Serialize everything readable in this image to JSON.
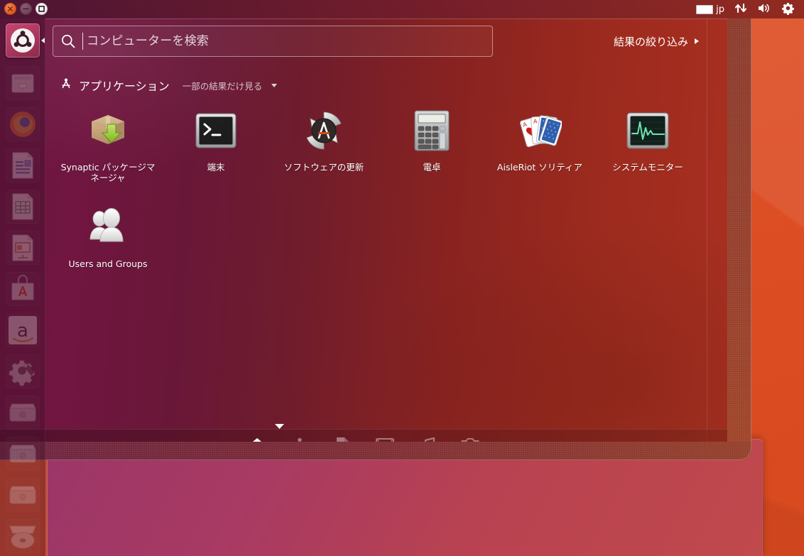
{
  "panel": {
    "window_buttons": [
      {
        "name": "close",
        "label": "閉じる"
      },
      {
        "name": "minimize",
        "label": "最小化"
      },
      {
        "name": "maximize",
        "label": "最大化"
      }
    ],
    "indicators": [
      {
        "name": "keyboard",
        "icon": "keyboard-layout-icon",
        "label": "jp"
      },
      {
        "name": "network",
        "icon": "network-arrows-icon",
        "label": ""
      },
      {
        "name": "sound",
        "icon": "volume-icon",
        "label": ""
      },
      {
        "name": "session",
        "icon": "gear-icon",
        "label": ""
      }
    ]
  },
  "dash": {
    "search": {
      "placeholder": "コンピューターを検索",
      "value": "",
      "icon": "search-icon"
    },
    "filter_results": {
      "label": "結果の絞り込み",
      "icon": "triangle-right-icon"
    },
    "category": {
      "icon": "applications-lens-icon",
      "title": "アプリケーション",
      "see_fewer_label": "一部の結果だけ見る",
      "arrow_icon": "chevron-down-icon"
    },
    "results": [
      {
        "label": "Synaptic パッケージマネージャ",
        "icon": "synaptic-package-manager-icon"
      },
      {
        "label": "端末",
        "icon": "terminal-icon"
      },
      {
        "label": "ソフトウェアの更新",
        "icon": "software-updater-icon"
      },
      {
        "label": "電卓",
        "icon": "calculator-icon"
      },
      {
        "label": "AisleRiot ソリティア",
        "icon": "aisleriot-solitaire-icon"
      },
      {
        "label": "システムモニター",
        "icon": "system-monitor-icon"
      },
      {
        "label": "Users and Groups",
        "icon": "users-and-groups-icon"
      }
    ],
    "lenses": [
      {
        "name": "home",
        "icon": "home-icon",
        "label": "ホーム",
        "active": true
      },
      {
        "name": "applications",
        "icon": "applications-icon",
        "label": "アプリケーション",
        "active": false
      },
      {
        "name": "files",
        "icon": "files-icon",
        "label": "ファイルとフォルダー",
        "active": false
      },
      {
        "name": "video",
        "icon": "video-icon",
        "label": "ビデオ",
        "active": false
      },
      {
        "name": "music",
        "icon": "music-icon",
        "label": "ミュージック",
        "active": false
      },
      {
        "name": "photos",
        "icon": "photos-icon",
        "label": "写真",
        "active": false
      }
    ],
    "collapse_icon": "chevron-down-small-icon"
  },
  "launcher": {
    "items": [
      {
        "name": "ubuntu-dash",
        "icon": "ubuntu-logo-icon",
        "label": "Dash ホーム",
        "active": true
      },
      {
        "name": "files",
        "icon": "file-manager-icon",
        "label": "ファイル",
        "active": false
      },
      {
        "name": "firefox",
        "icon": "firefox-icon",
        "label": "Firefox ウェブ・ブラウザー",
        "active": false
      },
      {
        "name": "writer",
        "icon": "libreoffice-writer-icon",
        "label": "LibreOffice Writer",
        "active": false
      },
      {
        "name": "calc",
        "icon": "libreoffice-calc-icon",
        "label": "LibreOffice Calc",
        "active": false
      },
      {
        "name": "impress",
        "icon": "libreoffice-impress-icon",
        "label": "LibreOffice Impress",
        "active": false
      },
      {
        "name": "software-center",
        "icon": "ubuntu-software-center-icon",
        "label": "Ubuntu ソフトウェアセンター",
        "active": false
      },
      {
        "name": "amazon",
        "icon": "amazon-icon",
        "label": "Amazon",
        "active": false
      },
      {
        "name": "system-settings",
        "icon": "system-settings-icon",
        "label": "システム設定",
        "active": false
      },
      {
        "name": "drive-1",
        "icon": "drive-icon",
        "label": "ドライブ",
        "active": false
      },
      {
        "name": "drive-2",
        "icon": "drive-icon",
        "label": "ドライブ",
        "active": false
      },
      {
        "name": "drive-3",
        "icon": "drive-icon",
        "label": "ドライブ",
        "active": false
      },
      {
        "name": "disc",
        "icon": "optical-disc-icon",
        "label": "ディスク",
        "active": false
      }
    ]
  },
  "colors": {
    "dash_left": "#6d1641",
    "dash_right": "#a83020",
    "desktop": "#dd4f26",
    "panel": "#3a1926",
    "accent_orange": "#dd4814",
    "text": "#ffffff"
  }
}
